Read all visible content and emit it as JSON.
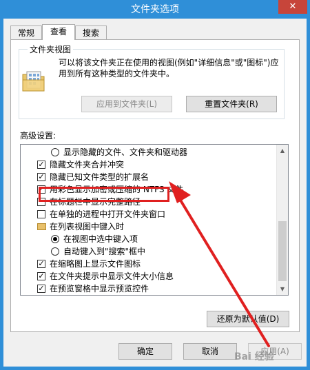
{
  "window": {
    "title": "文件夹选项",
    "close_glyph": "✕"
  },
  "tabs": [
    {
      "label": "常规",
      "active": false
    },
    {
      "label": "查看",
      "active": true
    },
    {
      "label": "搜索",
      "active": false
    }
  ],
  "folder_views": {
    "title": "文件夹视图",
    "description": "可以将该文件夹正在使用的视图(例如\"详细信息\"或\"图标\")应用到所有这种类型的文件夹中。",
    "apply_button": "应用到文件夹(L)",
    "reset_button": "重置文件夹(R)",
    "icon": "folder-view-icon"
  },
  "advanced": {
    "label": "高级设置:",
    "items": [
      {
        "type": "radio",
        "checked": false,
        "label": "显示隐藏的文件、文件夹和驱动器"
      },
      {
        "type": "checkbox",
        "checked": true,
        "label": "隐藏文件夹合并冲突"
      },
      {
        "type": "checkbox",
        "checked": true,
        "label": "隐藏已知文件类型的扩展名"
      },
      {
        "type": "checkbox",
        "checked": true,
        "label": "用彩色显示加密或压缩的 NTFS 文件"
      },
      {
        "type": "checkbox",
        "checked": false,
        "label": "在标题栏中显示完整路径"
      },
      {
        "type": "checkbox",
        "checked": false,
        "label": "在单独的进程中打开文件夹窗口"
      },
      {
        "type": "folder",
        "label": "在列表视图中键入时"
      },
      {
        "type": "radio",
        "checked": true,
        "label": "在视图中选中键入项"
      },
      {
        "type": "radio",
        "checked": false,
        "label": "自动键入到\"搜索\"框中"
      },
      {
        "type": "checkbox",
        "checked": true,
        "label": "在缩略图上显示文件图标"
      },
      {
        "type": "checkbox",
        "checked": true,
        "label": "在文件夹提示中显示文件大小信息"
      },
      {
        "type": "checkbox",
        "checked": true,
        "label": "在预览窗格中显示预览控件"
      }
    ],
    "restore_button": "还原为默认值(D)"
  },
  "footer": {
    "ok": "确定",
    "cancel": "取消",
    "apply": "应用(A)"
  },
  "watermark": "Bai 经验"
}
